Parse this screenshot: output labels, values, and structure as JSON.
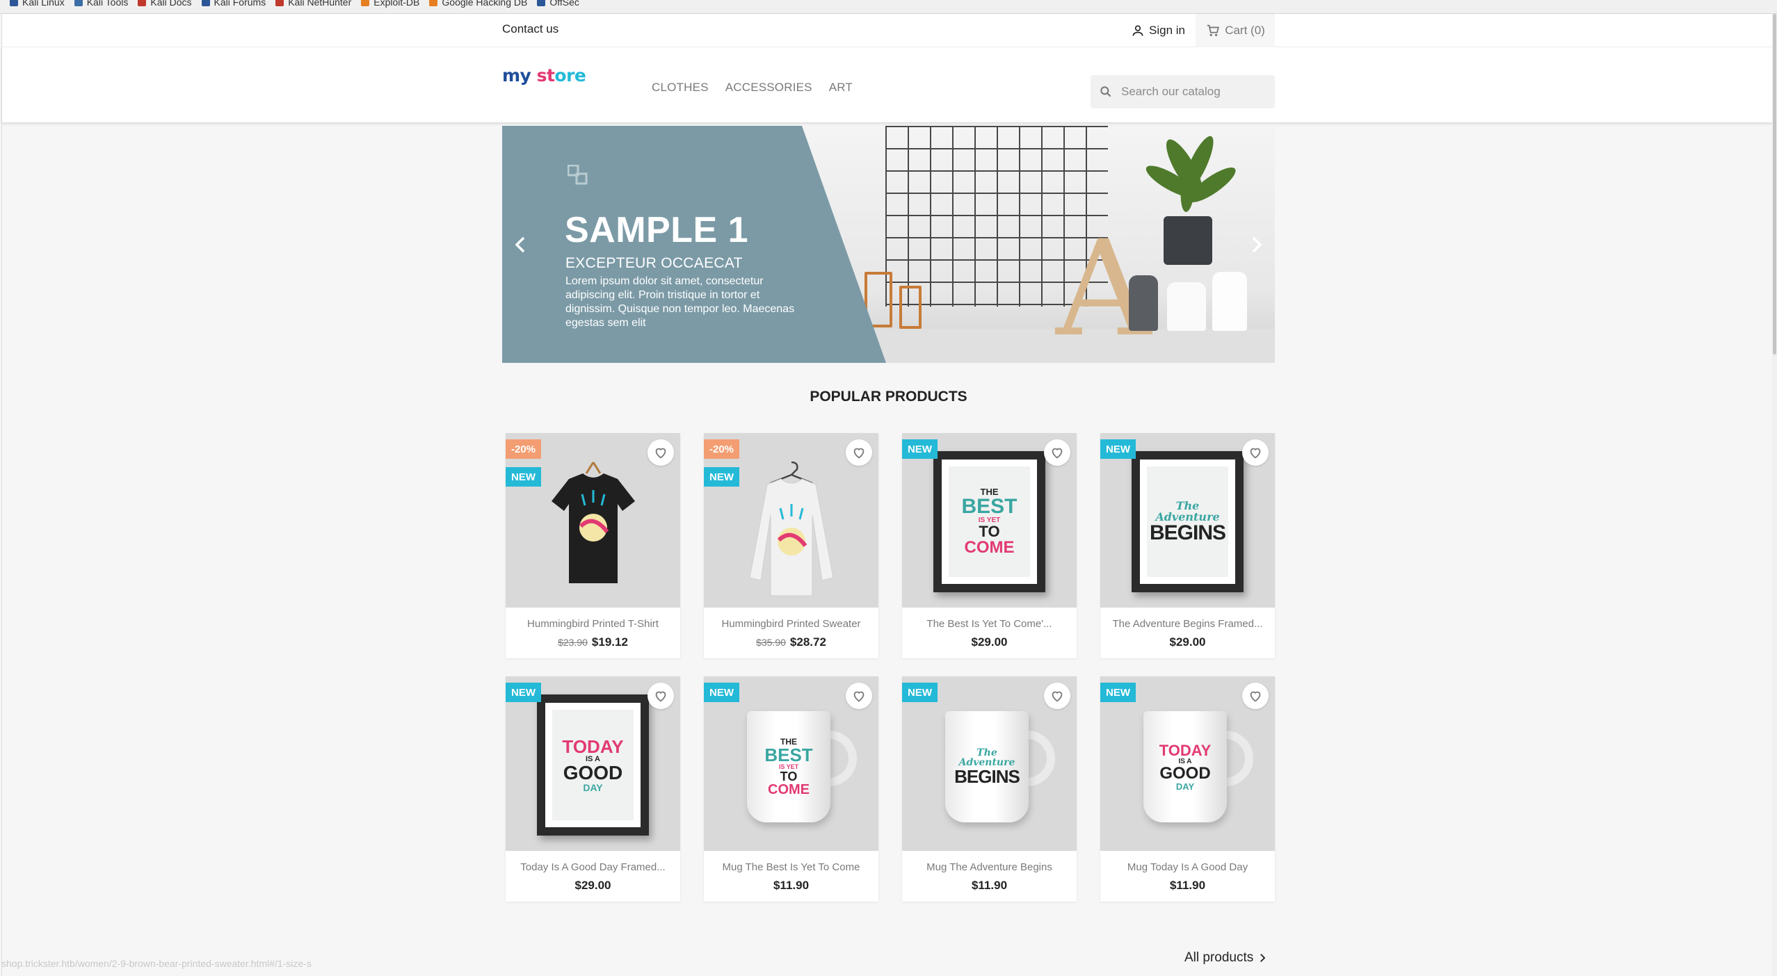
{
  "browser": {
    "bookmarks": [
      {
        "label": "Kali Linux",
        "icon": "kali-dragon-icon",
        "color": "#2b5797"
      },
      {
        "label": "Kali Tools",
        "icon": "kali-tools-icon",
        "color": "#3a6ea5"
      },
      {
        "label": "Kali Docs",
        "icon": "kali-docs-icon",
        "color": "#c0392b"
      },
      {
        "label": "Kali Forums",
        "icon": "kali-forums-icon",
        "color": "#2b5797"
      },
      {
        "label": "Kali NetHunter",
        "icon": "nethunter-icon",
        "color": "#c0392b"
      },
      {
        "label": "Exploit-DB",
        "icon": "exploit-db-icon",
        "color": "#e67e22"
      },
      {
        "label": "Google Hacking DB",
        "icon": "ghdb-icon",
        "color": "#e67e22"
      },
      {
        "label": "OffSec",
        "icon": "offsec-icon",
        "color": "#2b5797"
      }
    ],
    "status_url": "shop.trickster.htb/women/2-9-brown-bear-printed-sweater.html#/1-size-s"
  },
  "topnav": {
    "contact": "Contact us",
    "signin": "Sign in",
    "cart": "Cart (0)"
  },
  "header": {
    "logo_parts": [
      "my",
      " st",
      "ore"
    ],
    "menu": [
      "CLOTHES",
      "ACCESSORIES",
      "ART"
    ],
    "search_placeholder": "Search our catalog"
  },
  "slider": {
    "title": "SAMPLE 1",
    "subtitle": "EXCEPTEUR OCCAECAT",
    "text": "Lorem ipsum dolor sit amet, consectetur adipiscing elit. Proin tristique in tortor et dignissim. Quisque non tempor leo. Maecenas egestas sem elit",
    "band_color": "#7b9aa6"
  },
  "section": {
    "title": "POPULAR PRODUCTS",
    "all_products": "All products"
  },
  "products": [
    {
      "name": "Hummingbird Printed T-Shirt",
      "old_price": "$23.90",
      "price": "$19.12",
      "discount": "-20%",
      "badge": "NEW"
    },
    {
      "name": "Hummingbird Printed Sweater",
      "old_price": "$35.90",
      "price": "$28.72",
      "discount": "-20%",
      "badge": "NEW"
    },
    {
      "name": "The Best Is Yet To Come'...",
      "price": "$29.00",
      "badge": "NEW"
    },
    {
      "name": "The Adventure Begins Framed...",
      "price": "$29.00",
      "badge": "NEW"
    },
    {
      "name": "Today Is A Good Day Framed...",
      "price": "$29.00",
      "badge": "NEW"
    },
    {
      "name": "Mug The Best Is Yet To Come",
      "price": "$11.90",
      "badge": "NEW"
    },
    {
      "name": "Mug The Adventure Begins",
      "price": "$11.90",
      "badge": "NEW"
    },
    {
      "name": "Mug Today Is A Good Day",
      "price": "$11.90",
      "badge": "NEW"
    }
  ],
  "art_text": {
    "best": [
      "THE",
      "BEST",
      "IS YET",
      "TO",
      "COME"
    ],
    "adventure": [
      "The",
      "Adventure",
      "BEGINS"
    ],
    "today": [
      "TODAY",
      "IS A",
      "GOOD",
      "DAY"
    ]
  },
  "colors": {
    "accent": "#24b9d7",
    "discount": "#f39d72",
    "text": "#232323",
    "muted": "#7a7a7a",
    "pink": "#e23a73",
    "teal": "#3aa6a1"
  }
}
